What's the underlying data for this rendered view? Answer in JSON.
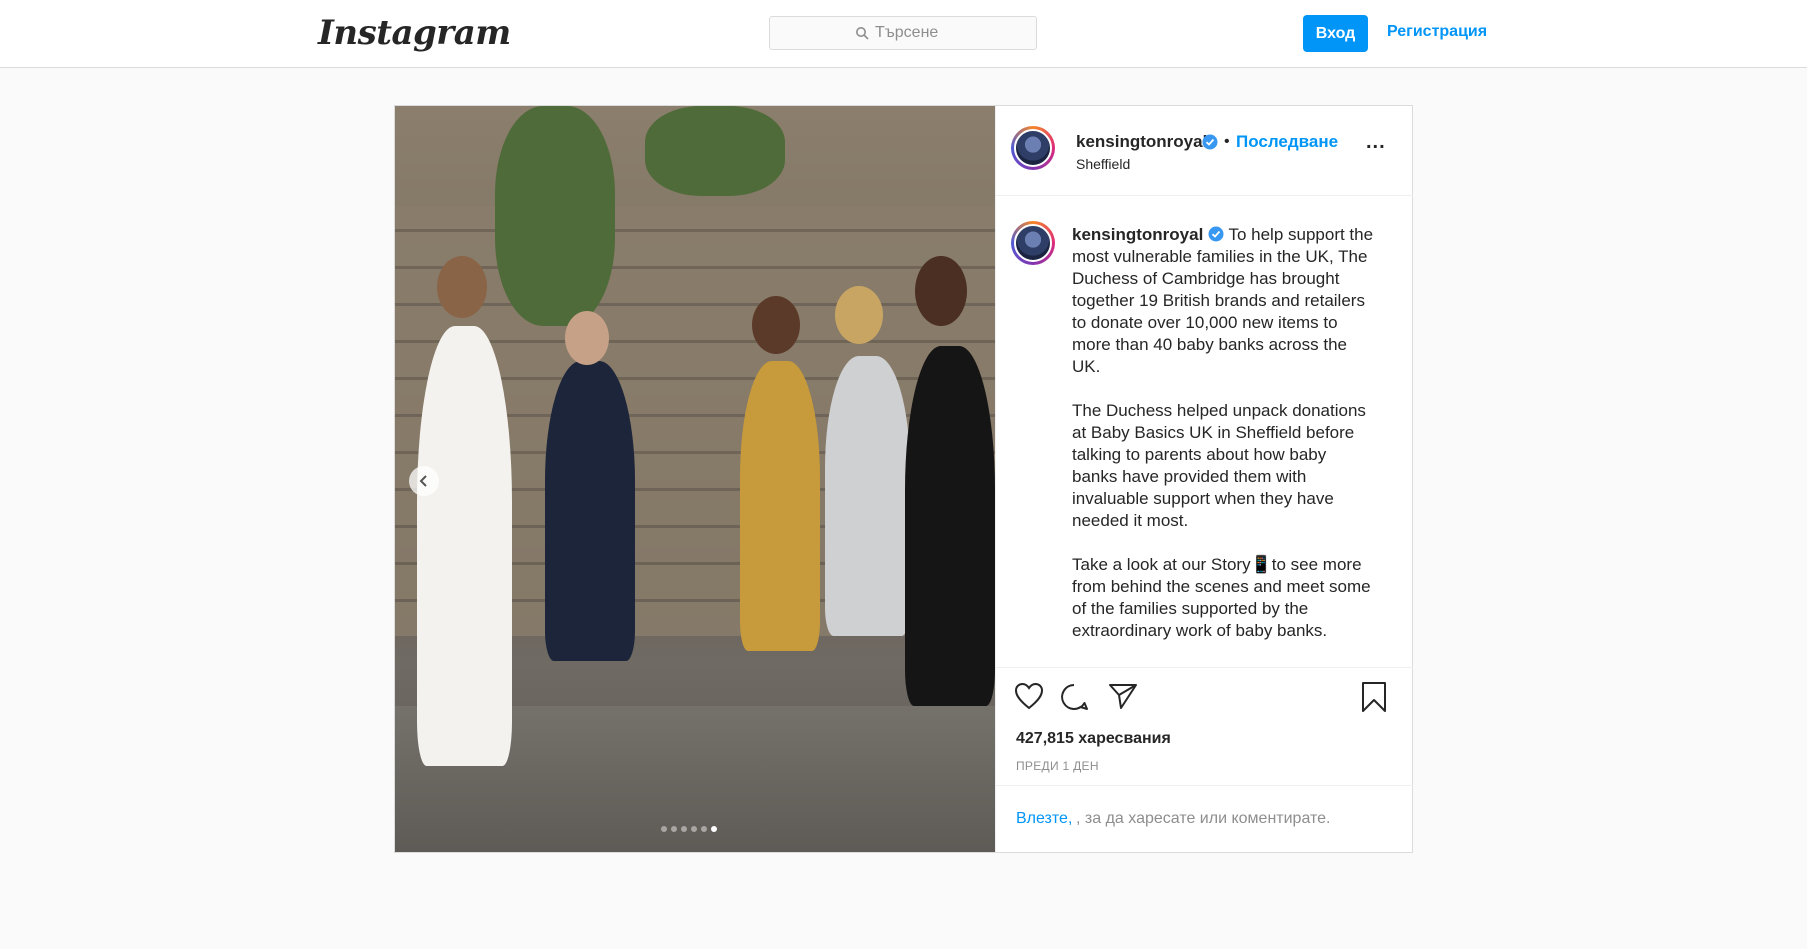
{
  "nav": {
    "logo": "Instagram",
    "search_placeholder": "Търсене",
    "login_label": "Вход",
    "signup_label": "Регистрация"
  },
  "post": {
    "username": "kensingtonroyal",
    "follow_separator": "•",
    "follow_label": "Последване",
    "location": "Sheffield",
    "more": "...",
    "caption": {
      "p1": "To help support the most vulnerable families in the UK, The Duchess of Cambridge has brought together 19 British brands and retailers to donate over 10,000 new items to more than 40 baby banks across the UK.",
      "p2": "The Duchess helped unpack donations at Baby Basics UK in Sheffield before talking to parents about how baby banks have provided them with invaluable support when they have needed it most.",
      "p3a": "Take a look at our Story",
      "p3_emoji": "📱",
      "p3b": "to see more from behind the scenes and meet some of the families supported by the extraordinary work of baby banks."
    },
    "likes": "427,815 харесвания",
    "time": "ПРЕДИ 1 ДЕН",
    "login_prompt_link": "Влезте,",
    "login_prompt_rest": ", за да харесате или коментирате."
  },
  "carousel": {
    "slides": 6,
    "active_index": 5
  },
  "colors": {
    "accent": "#0095f6",
    "border": "#dbdbdb",
    "background": "#fafafa"
  },
  "icons": [
    "search-icon",
    "verified-icon",
    "more-options-icon",
    "heart-icon",
    "comment-icon",
    "share-icon",
    "bookmark-icon",
    "chevron-left-icon"
  ]
}
